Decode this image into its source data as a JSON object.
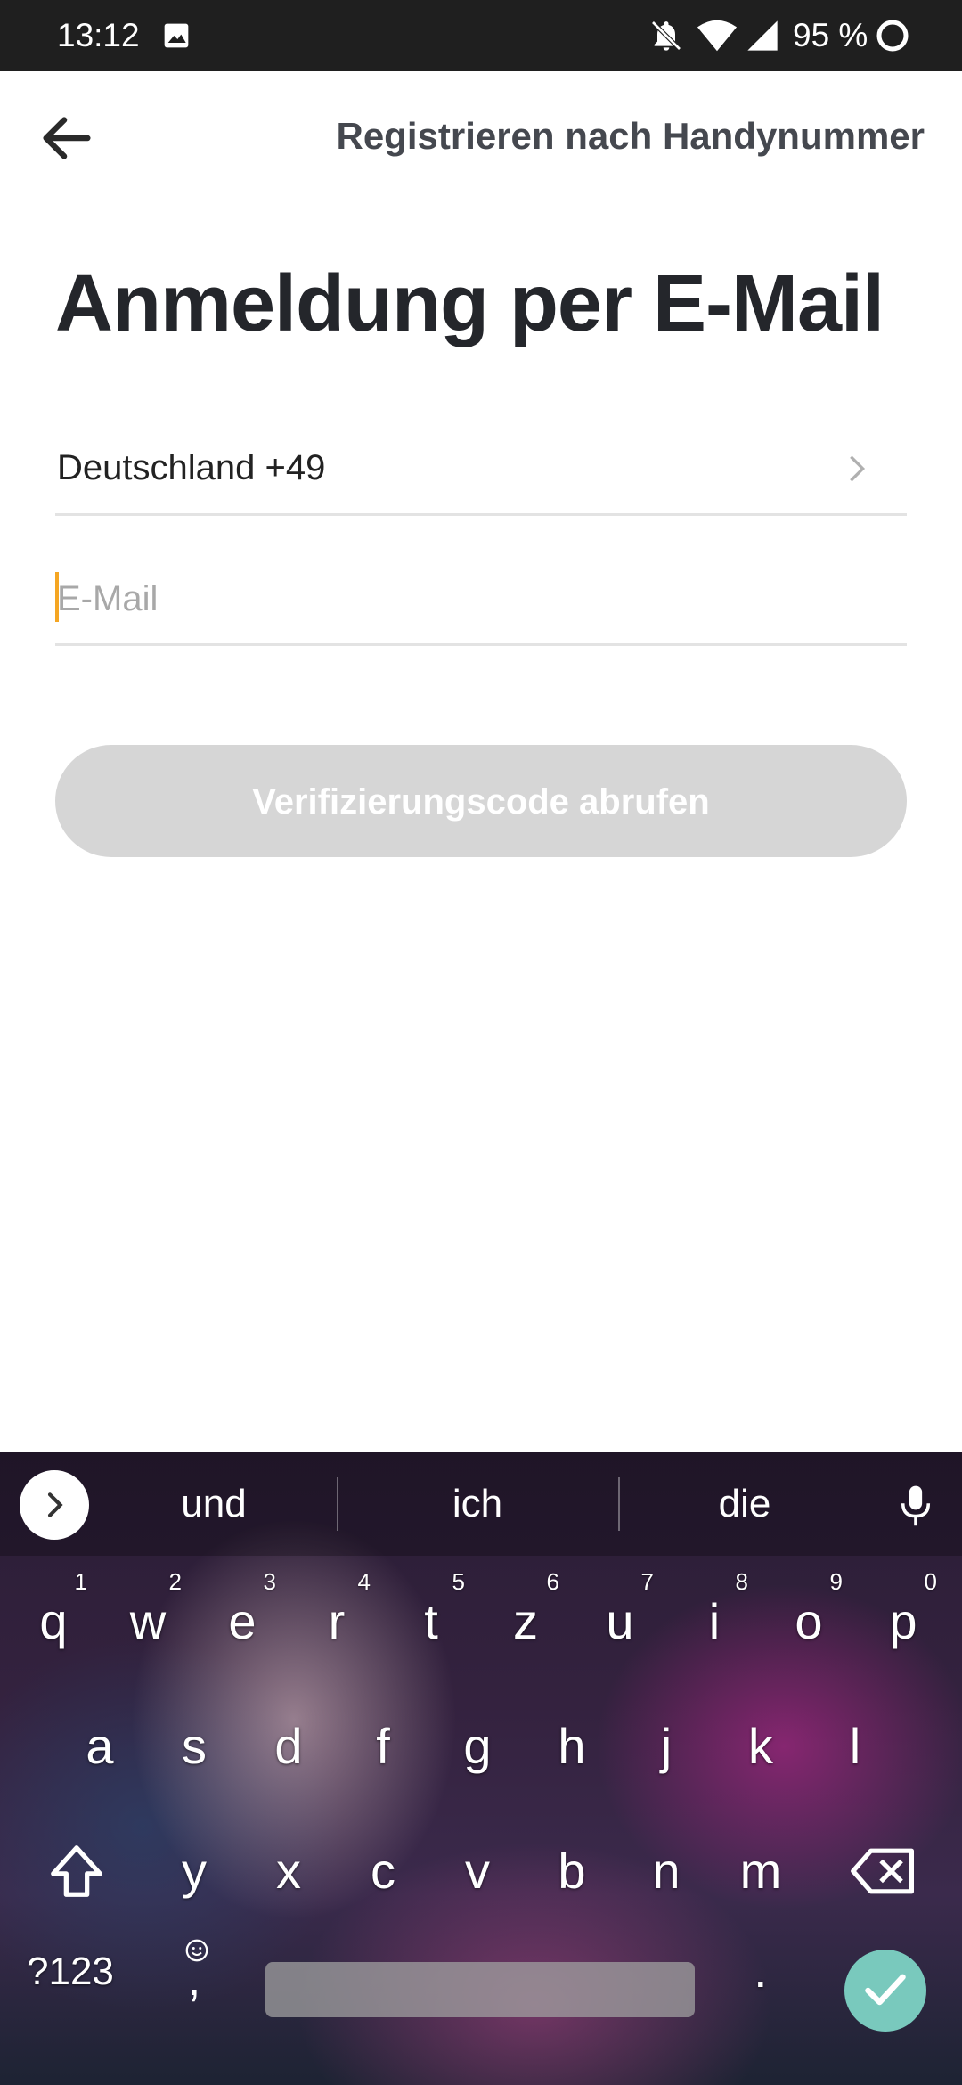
{
  "status_bar": {
    "time": "13:12",
    "battery": "95 %",
    "icons": [
      "image-icon",
      "bell-off-icon",
      "wifi-icon",
      "signal-icon",
      "battery-icon"
    ]
  },
  "header": {
    "back_icon": "arrow-left-icon",
    "link_label": "Registrieren nach Handynummer"
  },
  "title": "Anmeldung per E-Mail",
  "form": {
    "country": "Deutschland +49",
    "email_placeholder": "E-Mail",
    "email_value": "",
    "submit_label": "Verifizierungscode abrufen"
  },
  "keyboard": {
    "suggestions": [
      "und",
      "ich",
      "die"
    ],
    "row1": [
      {
        "l": "q",
        "d": "1"
      },
      {
        "l": "w",
        "d": "2"
      },
      {
        "l": "e",
        "d": "3"
      },
      {
        "l": "r",
        "d": "4"
      },
      {
        "l": "t",
        "d": "5"
      },
      {
        "l": "z",
        "d": "6"
      },
      {
        "l": "u",
        "d": "7"
      },
      {
        "l": "i",
        "d": "8"
      },
      {
        "l": "o",
        "d": "9"
      },
      {
        "l": "p",
        "d": "0"
      }
    ],
    "row2": [
      "a",
      "s",
      "d",
      "f",
      "g",
      "h",
      "j",
      "k",
      "l"
    ],
    "row3": [
      "y",
      "x",
      "c",
      "v",
      "b",
      "n",
      "m"
    ],
    "mode_label": "?123",
    "comma_label": ",",
    "period_label": ".",
    "colors": {
      "accent": "#79c9bd",
      "caret": "#f5a623"
    }
  }
}
